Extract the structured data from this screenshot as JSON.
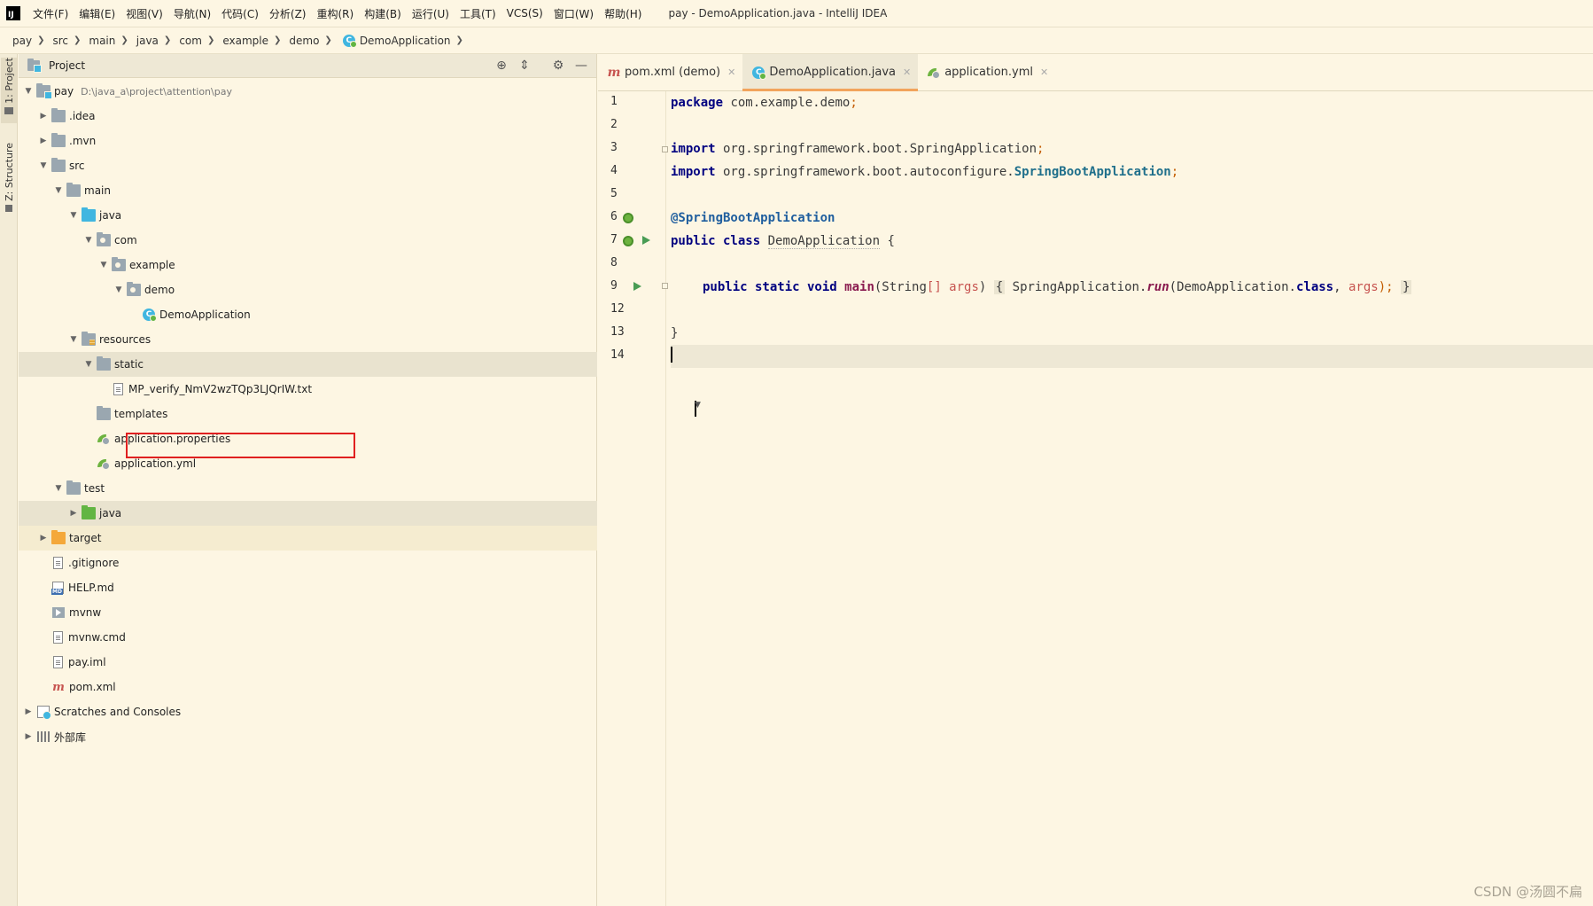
{
  "menu": {
    "items": [
      "文件(F)",
      "编辑(E)",
      "视图(V)",
      "导航(N)",
      "代码(C)",
      "分析(Z)",
      "重构(R)",
      "构建(B)",
      "运行(U)",
      "工具(T)",
      "VCS(S)",
      "窗口(W)",
      "帮助(H)"
    ],
    "window_title": "pay - DemoApplication.java - IntelliJ IDEA"
  },
  "breadcrumb": [
    "pay",
    "src",
    "main",
    "java",
    "com",
    "example",
    "demo",
    "DemoApplication"
  ],
  "tool_stripe": {
    "project": "1: Project",
    "structure": "Z: Structure"
  },
  "project_panel": {
    "title": "Project"
  },
  "tree": [
    {
      "label": "pay",
      "path": "D:\\java_a\\project\\attention\\pay",
      "depth": 0,
      "arrow": "down",
      "icon": "module-folder"
    },
    {
      "label": ".idea",
      "depth": 1,
      "arrow": "right",
      "icon": "folder"
    },
    {
      "label": ".mvn",
      "depth": 1,
      "arrow": "right",
      "icon": "folder"
    },
    {
      "label": "src",
      "depth": 1,
      "arrow": "down",
      "icon": "folder"
    },
    {
      "label": "main",
      "depth": 2,
      "arrow": "down",
      "icon": "folder"
    },
    {
      "label": "java",
      "depth": 3,
      "arrow": "down",
      "icon": "source-folder"
    },
    {
      "label": "com",
      "depth": 4,
      "arrow": "down",
      "icon": "package"
    },
    {
      "label": "example",
      "depth": 5,
      "arrow": "down",
      "icon": "package"
    },
    {
      "label": "demo",
      "depth": 6,
      "arrow": "down",
      "icon": "package"
    },
    {
      "label": "DemoApplication",
      "depth": 7,
      "arrow": "none",
      "icon": "spring-class"
    },
    {
      "label": "resources",
      "depth": 3,
      "arrow": "down",
      "icon": "resources-folder"
    },
    {
      "label": "static",
      "depth": 4,
      "arrow": "down",
      "icon": "folder",
      "selected": true
    },
    {
      "label": "MP_verify_NmV2wzTQp3LJQrIW.txt",
      "depth": 5,
      "arrow": "none",
      "icon": "text-file"
    },
    {
      "label": "templates",
      "depth": 4,
      "arrow": "none",
      "icon": "folder"
    },
    {
      "label": "application.properties",
      "depth": 4,
      "arrow": "none",
      "icon": "spring-config"
    },
    {
      "label": "application.yml",
      "depth": 4,
      "arrow": "none",
      "icon": "spring-config"
    },
    {
      "label": "test",
      "depth": 2,
      "arrow": "down",
      "icon": "folder"
    },
    {
      "label": "java",
      "depth": 3,
      "arrow": "right",
      "icon": "test-folder",
      "selected": true
    },
    {
      "label": "target",
      "depth": 1,
      "arrow": "right",
      "icon": "excluded-folder",
      "excluded": true
    },
    {
      "label": ".gitignore",
      "depth": 1,
      "arrow": "none",
      "icon": "text-file"
    },
    {
      "label": "HELP.md",
      "depth": 1,
      "arrow": "none",
      "icon": "markdown-file"
    },
    {
      "label": "mvnw",
      "depth": 1,
      "arrow": "none",
      "icon": "exec-file"
    },
    {
      "label": "mvnw.cmd",
      "depth": 1,
      "arrow": "none",
      "icon": "text-file"
    },
    {
      "label": "pay.iml",
      "depth": 1,
      "arrow": "none",
      "icon": "text-file"
    },
    {
      "label": "pom.xml",
      "depth": 1,
      "arrow": "none",
      "icon": "maven-file"
    },
    {
      "label": "Scratches and Consoles",
      "depth": 0,
      "arrow": "right",
      "icon": "scratch"
    },
    {
      "label": "外部库",
      "depth": 0,
      "arrow": "right",
      "icon": "library"
    }
  ],
  "tabs": [
    {
      "label": "pom.xml (demo)",
      "icon": "maven-file",
      "active": false
    },
    {
      "label": "DemoApplication.java",
      "icon": "spring-class",
      "active": true
    },
    {
      "label": "application.yml",
      "icon": "spring-config",
      "active": false
    }
  ],
  "editor": {
    "line_numbers": [
      "1",
      "2",
      "3",
      "4",
      "5",
      "6",
      "7",
      "8",
      "9",
      "12",
      "13",
      "14"
    ],
    "code": {
      "l1_kw": "package",
      "l1_rest": " com.example.demo",
      "l1_semi": ";",
      "l3_kw": "import",
      "l3_rest": " org.springframework.boot.SpringApplication",
      "l3_semi": ";",
      "l4_kw": "import",
      "l4_rest": " org.springframework.boot.autoconfigure.",
      "l4_cls": "SpringBootApplication",
      "l4_semi": ";",
      "l6_annot": "@SpringBootApplication",
      "l7_kw": "public class",
      "l7_sp": " ",
      "l7_cls": "DemoApplication",
      "l7_rest": " {",
      "l9_kw": "public static void",
      "l9_sp": " ",
      "l9_method": "main",
      "l9_p1": "(String",
      "l9_arr": "[] args",
      "l9_p2": ")",
      "l9_ob": "{",
      "l9_mid": " SpringApplication.",
      "l9_run": "run",
      "l9_p3": "(DemoApplication.",
      "l9_class": "class",
      "l9_comma": ", ",
      "l9_args": "args",
      "l9_p4": ");",
      "l9_cb": "}",
      "l13_brace": "}"
    }
  },
  "watermark": "CSDN @汤圆不扁",
  "colors": {
    "background": "#fdf6e3",
    "selection": "#e9e3cf",
    "excluded": "#f5ecd0",
    "keyword": "#000080",
    "highlight_box": "#e02020",
    "active_tab_underline": "#f2a45c"
  }
}
